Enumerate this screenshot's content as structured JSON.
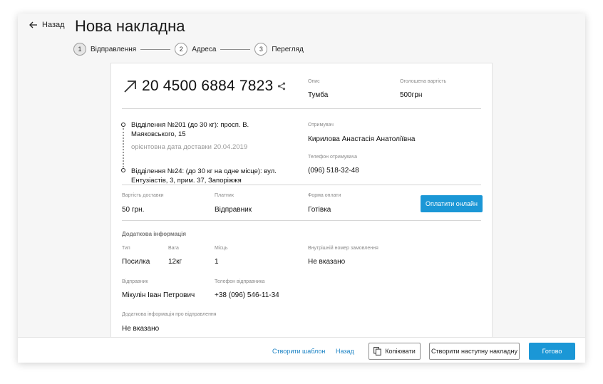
{
  "header": {
    "back_label": "Назад",
    "title": "Нова накладна"
  },
  "stepper": [
    {
      "number": "1",
      "label": "Відправлення",
      "active": true
    },
    {
      "number": "2",
      "label": "Адреса",
      "active": false
    },
    {
      "number": "3",
      "label": "Перегляд",
      "active": false
    }
  ],
  "shipment": {
    "tracking_number": "20 4500 6884 7823",
    "description_label": "Опис",
    "description_value": "Тумба",
    "declared_value_label": "Оголошена вартість",
    "declared_value": "500грн"
  },
  "route": {
    "from": "Відділення №201 (до 30 кг): просп. В. Маяковського, 15",
    "estimated_delivery": "орієнтовна дата доставки 20.04.2019",
    "to": "Відділення №24: (до 30 кг на одне місце): вул. Ентузіастів, 3, прим. 37, Запоріжжя",
    "recipient_label": "Отримувач",
    "recipient_name": "Кирилова Анастасія Анатоліївна",
    "recipient_phone_label": "Телефон отримувача",
    "recipient_phone": "(096) 518-32-48"
  },
  "payment": {
    "delivery_cost_label": "Вартість доставки",
    "delivery_cost": "50 грн.",
    "payer_label": "Платник",
    "payer": "Відправник",
    "method_label": "Форма оплати",
    "method": "Готівка",
    "pay_online_button": "Оплатити онлайн"
  },
  "additional": {
    "section_title": "Додаткова інформація",
    "type_label": "Тип",
    "type_value": "Посилка",
    "weight_label": "Вага",
    "weight_value": "12кг",
    "places_label": "Місць",
    "places_value": "1",
    "internal_order_label": "Внутрішній номер замовлення",
    "internal_order_value": "Не вказано",
    "sender_label": "Відправник",
    "sender_value": "Мікулін Іван Петрович",
    "sender_phone_label": "Телефон відправника",
    "sender_phone_value": "+38 (096) 546-11-34",
    "extra_info_label": "Додаткова інформація про відправлення",
    "extra_info_value": "Не вказано"
  },
  "footer": {
    "create_template": "Створити шаблон",
    "back": "Назад",
    "copy": "Копіювати",
    "create_next": "Створити наступну накладну",
    "done": "Готово"
  },
  "colors": {
    "accent": "#1b97d6",
    "link": "#1b82c4"
  }
}
